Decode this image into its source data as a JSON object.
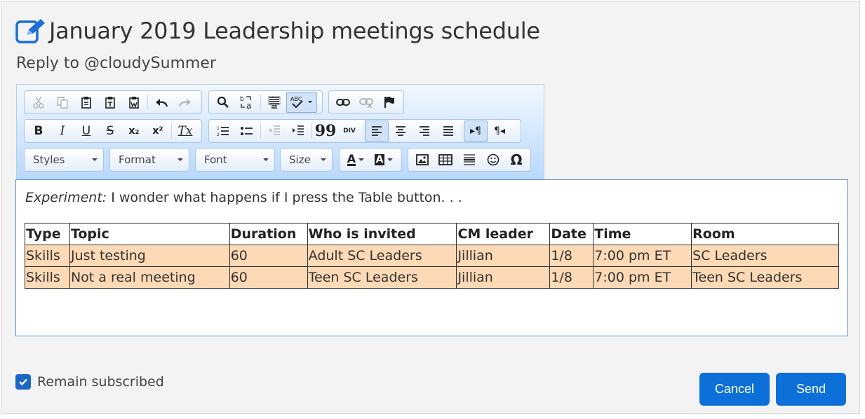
{
  "dialog": {
    "title": "January 2019 Leadership meetings schedule",
    "title_icon": "edit-icon",
    "reply_to": "Reply to @cloudySummer"
  },
  "toolbar": {
    "row1": [
      "cut-icon",
      "copy-icon",
      "paste-icon",
      "paste-text-icon",
      "paste-word-icon",
      "undo-icon",
      "redo-icon",
      "find-icon",
      "replace-icon",
      "select-all-icon",
      "spellcheck-icon",
      "link-icon",
      "unlink-icon",
      "anchor-icon"
    ],
    "row2": {
      "bold": "B",
      "italic": "I",
      "underline": "U",
      "strike": "S",
      "subscript": "x₂",
      "superscript": "x²",
      "remove_format": "Tx",
      "blockquote": "99",
      "div": "DIV",
      "ltr": "▸¶",
      "rtl": "¶◂"
    },
    "combos": {
      "styles": "Styles",
      "format": "Format",
      "font": "Font",
      "size": "Size"
    },
    "text_color": "A",
    "bg_color": "A",
    "special_char": "Ω"
  },
  "editor": {
    "experiment_label": "Experiment:",
    "experiment_text": " I wonder what happens if I press the Table button. . .",
    "table": {
      "headers": [
        "Type",
        "Topic",
        "Duration",
        "Who is invited",
        "CM leader",
        "Date",
        "Time",
        "Room"
      ],
      "rows": [
        [
          "Skills",
          "Just testing",
          "60",
          "Adult SC Leaders",
          "Jillian",
          "1/8",
          "7:00 pm ET",
          "SC Leaders"
        ],
        [
          "Skills",
          "Not a real meeting",
          "60",
          "Teen SC Leaders",
          "Jillian",
          "1/8",
          "7:00 pm ET",
          "Teen SC Leaders"
        ]
      ],
      "row_color": "#fdd9b5"
    }
  },
  "footer": {
    "remain_subscribed": "Remain subscribed",
    "remain_checked": true,
    "cancel": "Cancel",
    "send": "Send",
    "accent": "#0d6fd8"
  }
}
